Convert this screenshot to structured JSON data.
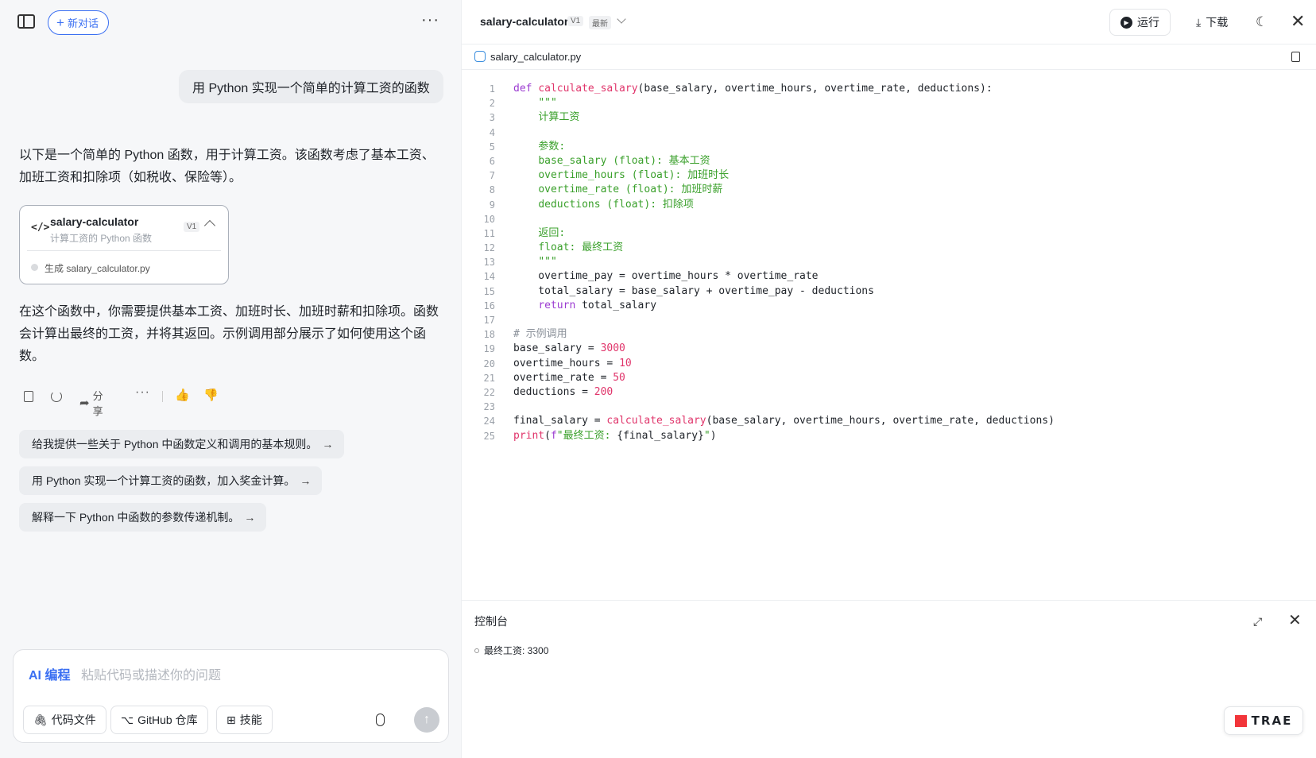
{
  "left": {
    "new_chat_label": "新对话",
    "user_message": "用 Python 实现一个简单的计算工资的函数",
    "answer_intro": "以下是一个简单的 Python 函数，用于计算工资。该函数考虑了基本工资、加班工资和扣除项（如税收、保险等）。",
    "artifact": {
      "title": "salary-calculator",
      "subtitle": "计算工资的 Python 函数",
      "version": "V1",
      "generated": "生成 salary_calculator.py"
    },
    "answer_outro": "在这个函数中，你需要提供基本工资、加班时长、加班时薪和扣除项。函数会计算出最终的工资，并将其返回。示例调用部分展示了如何使用这个函数。",
    "share_label": "分享",
    "suggestions": [
      "给我提供一些关于 Python 中函数定义和调用的基本规则。",
      "用 Python 实现一个计算工资的函数，加入奖金计算。",
      "解释一下 Python 中函数的参数传递机制。"
    ],
    "input": {
      "mode_label": "AI 编程",
      "placeholder": "粘贴代码或描述你的问题",
      "tools": [
        "代码文件",
        "GitHub 仓库",
        "技能"
      ]
    }
  },
  "right": {
    "title": "salary-calculator",
    "version": "V1",
    "latest": "最新",
    "run_label": "运行",
    "download_label": "下载",
    "file_name": "salary_calculator.py",
    "code_lines": [
      {
        "n": "1",
        "html": "<span class='kw'>def</span> <span class='fn'>calculate_salary</span>(base_salary, overtime_hours, overtime_rate, deductions):"
      },
      {
        "n": "2",
        "html": "    <span class='str'>\"\"\"</span>"
      },
      {
        "n": "3",
        "html": "    <span class='str'>计算工资</span>"
      },
      {
        "n": "4",
        "html": ""
      },
      {
        "n": "5",
        "html": "    <span class='str'>参数:</span>"
      },
      {
        "n": "6",
        "html": "    <span class='str'>base_salary (float): 基本工资</span>"
      },
      {
        "n": "7",
        "html": "    <span class='str'>overtime_hours (float): 加班时长</span>"
      },
      {
        "n": "8",
        "html": "    <span class='str'>overtime_rate (float): 加班时薪</span>"
      },
      {
        "n": "9",
        "html": "    <span class='str'>deductions (float): 扣除项</span>"
      },
      {
        "n": "10",
        "html": ""
      },
      {
        "n": "11",
        "html": "    <span class='str'>返回:</span>"
      },
      {
        "n": "12",
        "html": "    <span class='str'>float: 最终工资</span>"
      },
      {
        "n": "13",
        "html": "    <span class='str'>\"\"\"</span>"
      },
      {
        "n": "14",
        "html": "    overtime_pay = overtime_hours * overtime_rate"
      },
      {
        "n": "15",
        "html": "    total_salary = base_salary + overtime_pay - deductions"
      },
      {
        "n": "16",
        "html": "    <span class='kw'>return</span> total_salary"
      },
      {
        "n": "17",
        "html": ""
      },
      {
        "n": "18",
        "html": "<span class='cmt'># 示例调用</span>"
      },
      {
        "n": "19",
        "html": "base_salary = <span class='num'>3000</span>"
      },
      {
        "n": "20",
        "html": "overtime_hours = <span class='num'>10</span>"
      },
      {
        "n": "21",
        "html": "overtime_rate = <span class='num'>50</span>"
      },
      {
        "n": "22",
        "html": "deductions = <span class='num'>200</span>"
      },
      {
        "n": "23",
        "html": ""
      },
      {
        "n": "24",
        "html": "final_salary = <span class='fn'>calculate_salary</span>(base_salary, overtime_hours, overtime_rate, deductions)"
      },
      {
        "n": "25",
        "html": "<span class='fn'>print</span>(<span class='kw'>f</span><span class='str'>\"最终工资: </span>{final_salary}<span class='str'>\"</span>)"
      }
    ],
    "console": {
      "title": "控制台",
      "output": "最终工资: 3300"
    },
    "brand": "TRAE"
  }
}
